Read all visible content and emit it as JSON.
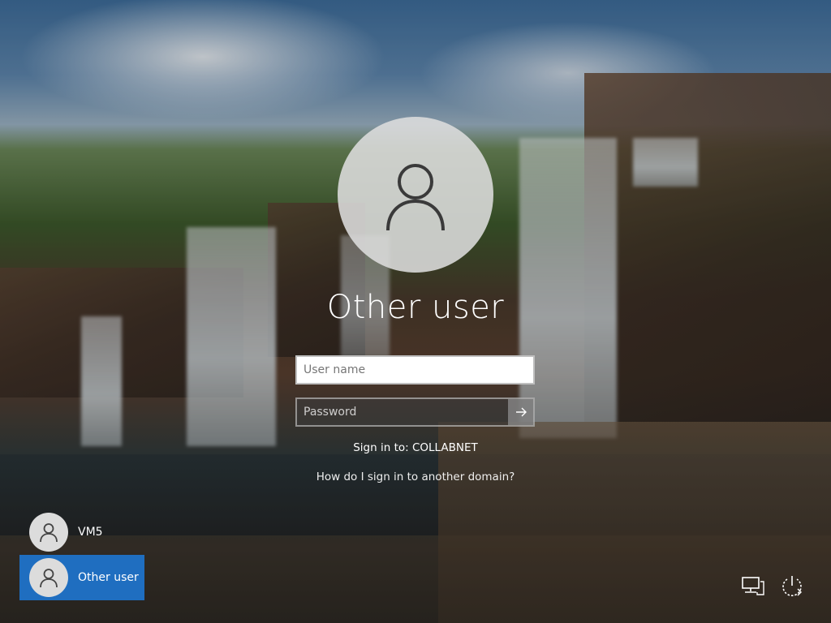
{
  "login": {
    "user_title": "Other user",
    "username_placeholder": "User name",
    "username_value": "",
    "password_placeholder": "Password",
    "sign_in_to": "Sign in to: COLLABNET",
    "domain_help_link": "How do I sign in to another domain?"
  },
  "user_list": [
    {
      "label": "VM5",
      "selected": false
    },
    {
      "label": "Other user",
      "selected": true
    }
  ],
  "icons": {
    "avatar": "person-icon",
    "submit": "arrow-right-icon",
    "network": "network-icon",
    "power": "power-icon"
  },
  "colors": {
    "selected_tile": "#1f6ec0",
    "avatar_circle": "#dddddd"
  }
}
